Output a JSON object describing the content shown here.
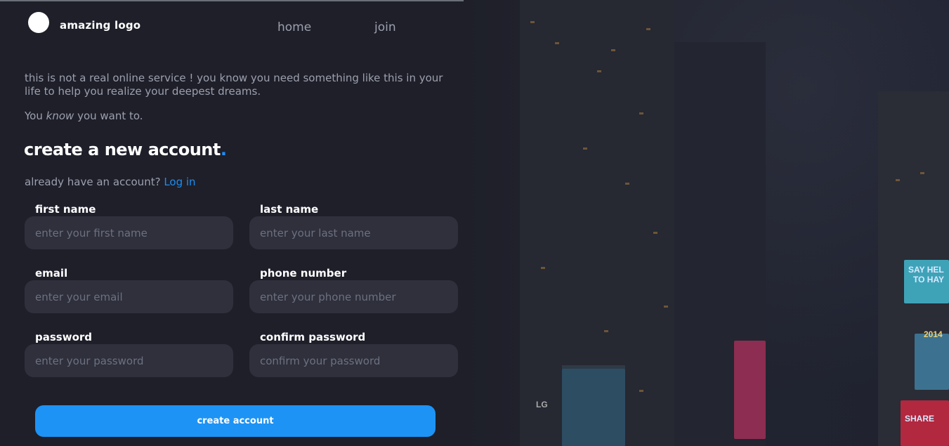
{
  "header": {
    "logo_text": "amazing logo",
    "nav": [
      "home",
      "join"
    ]
  },
  "intro": {
    "paragraph": "this is not a real online service ! you know you need something like this in your life to help you realize your deepest dreams.",
    "line_prefix": "You",
    "line_emphasis": "know",
    "line_suffix": "you want to."
  },
  "form": {
    "title": "create a new account",
    "title_dot": ".",
    "login_prompt": "already have an account?",
    "login_link": "Log in",
    "fields": {
      "first_name": {
        "label": "first name",
        "placeholder": "enter your first name"
      },
      "last_name": {
        "label": "last name",
        "placeholder": "enter your last name"
      },
      "email": {
        "label": "email",
        "placeholder": "enter your email"
      },
      "phone": {
        "label": "phone number",
        "placeholder": "enter your phone number"
      },
      "password": {
        "label": "password",
        "placeholder": "enter your password"
      },
      "confirm_password": {
        "label": "confirm password",
        "placeholder": "confirm your password"
      }
    },
    "submit_label": "create account"
  },
  "background": {
    "signs": [
      "SAY HEL",
      "TO HAY",
      "2014",
      "SHARE",
      "LG"
    ]
  },
  "colors": {
    "page_bg": "#1e1f29",
    "input_bg": "#2f303c",
    "accent": "#1d93f5",
    "link": "#1d8df0"
  }
}
